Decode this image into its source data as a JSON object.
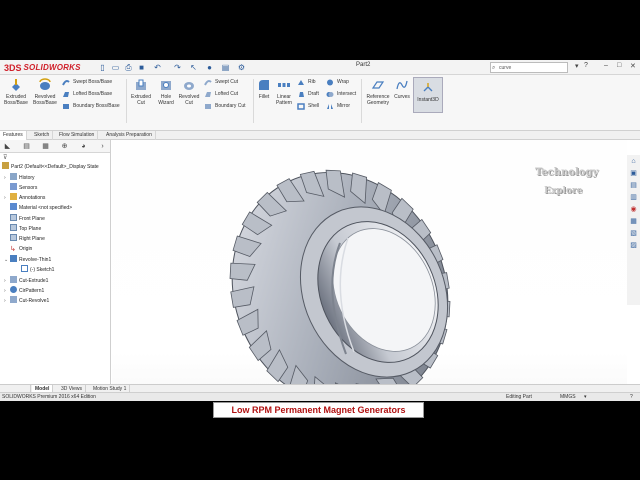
{
  "app": {
    "brand": "SOLIDWORKS",
    "document_title": "Part2",
    "search_placeholder": "curve"
  },
  "ribbon": {
    "extruded_boss": "Extruded Boss/Base",
    "revolved_boss": "Revolved Boss/Base",
    "swept_boss": "Swept Boss/Base",
    "lofted_boss": "Lofted Boss/Base",
    "boundary_boss": "Boundary Boss/Base",
    "extruded_cut": "Extruded Cut",
    "hole_wizard": "Hole Wizard",
    "revolved_cut": "Revolved Cut",
    "swept_cut": "Swept Cut",
    "lofted_cut": "Lofted Cut",
    "boundary_cut": "Boundary Cut",
    "fillet": "Fillet",
    "linear_pattern": "Linear Pattern",
    "rib": "Rib",
    "draft": "Draft",
    "shell": "Shell",
    "wrap": "Wrap",
    "intersect": "Intersect",
    "mirror": "Mirror",
    "reference_geometry": "Reference Geometry",
    "curves": "Curves",
    "instant3d": "Instant3D"
  },
  "command_tabs": [
    "Features",
    "Sketch",
    "Flow Simulation",
    "Analysis Preparation"
  ],
  "tree": {
    "root": "Part2  (Default<<Default>_Display State",
    "items": [
      "History",
      "Sensors",
      "Annotations",
      "Material <not specified>",
      "Front Plane",
      "Top Plane",
      "Right Plane",
      "Origin",
      "Revolve-Thin1",
      "(-) Sketch1",
      "Cut-Extrude1",
      "CirPattern1",
      "Cut-Revolve1"
    ]
  },
  "watermark": {
    "line1": "Technology",
    "line2": "Explore"
  },
  "bottom_tabs": [
    "Model",
    "3D Views",
    "Motion Study 1"
  ],
  "status": {
    "edition": "SOLIDWORKS Premium 2016 x64 Edition",
    "mode": "Editing Part",
    "units": "MMGS"
  },
  "caption": "Low RPM Permanent Magnet Generators",
  "colors": {
    "brand_red": "#d0202a",
    "caption_red": "#b01010",
    "icon_blue": "#2d5c9a",
    "tire_steel": "#9aa0ac"
  }
}
